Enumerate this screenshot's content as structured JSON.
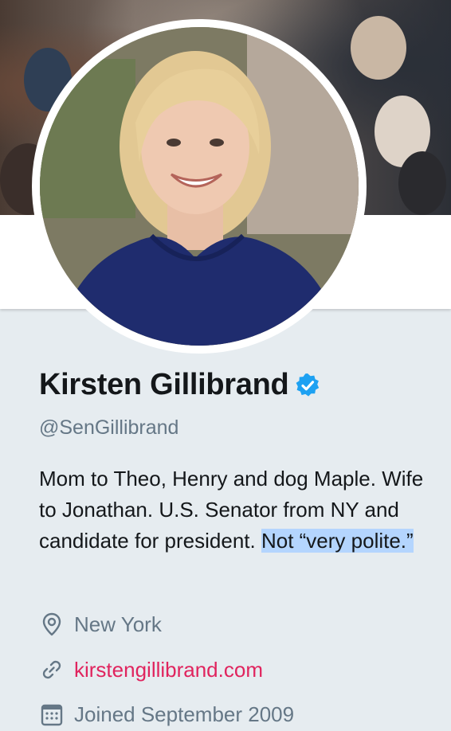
{
  "profile": {
    "name": "Kirsten Gillibrand",
    "handle": "@SenGillibrand",
    "bio_main": "Mom to Theo, Henry and dog Maple. Wife to Jonathan. U.S. Senator from NY and candidate for president. ",
    "bio_highlight": "Not “very polite.”",
    "location": "New York",
    "website": "kirstengillibrand.com",
    "joined": "Joined September 2009"
  },
  "icons": {
    "verified": "verified-badge-icon",
    "location": "location-pin-icon",
    "link": "link-icon",
    "calendar": "calendar-icon"
  },
  "colors": {
    "verified": "#1da1f2",
    "link": "#e0245e",
    "muted": "#657786",
    "text": "#14171a",
    "selection": "#b4d5fe"
  }
}
